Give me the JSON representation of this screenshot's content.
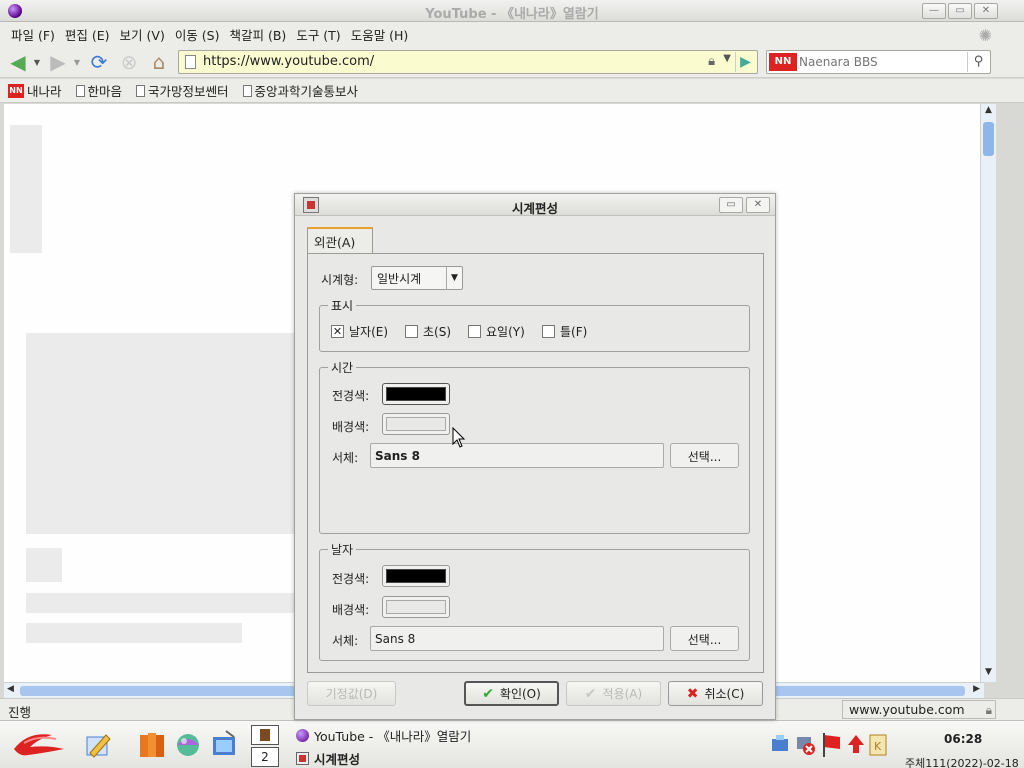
{
  "window": {
    "title": "YouTube - 《내나라》열람기"
  },
  "menu": [
    "파일 (F)",
    "편집 (E)",
    "보기 (V)",
    "이동 (S)",
    "책갈피 (B)",
    "도구 (T)",
    "도움말 (H)"
  ],
  "nav": {
    "url": "https://www.youtube.com/",
    "search_placeholder": "Naenara BBS",
    "search_engine": "NN"
  },
  "bookmarks": [
    "내나라",
    "한마음",
    "국가망정보쎈터",
    "중앙과학기술통보사"
  ],
  "status": {
    "text": "진행",
    "url": "www.youtube.com"
  },
  "taskbar": {
    "workspace": "2",
    "tasks": [
      "YouTube - 《내나라》열람기",
      "시계편성"
    ],
    "clock": "06:28",
    "date": "주체111(2022)-02-18"
  },
  "dialog": {
    "title": "시계편성",
    "tab": "외관(A)",
    "clock_type_label": "시계형:",
    "clock_type_value": "일반시계",
    "display_group": "표시",
    "checks": [
      {
        "label": "날자(E)",
        "checked": true
      },
      {
        "label": "초(S)",
        "checked": false
      },
      {
        "label": "요일(Y)",
        "checked": false
      },
      {
        "label": "틀(F)",
        "checked": false
      }
    ],
    "time_group": {
      "legend": "시간",
      "fg_label": "전경색:",
      "fg_color": "#000000",
      "bg_label": "배경색:",
      "bg_color": "#e8e8e6",
      "font_label": "서체:",
      "font_value": "Sans 8",
      "select_label": "선택..."
    },
    "date_group": {
      "legend": "날자",
      "fg_label": "전경색:",
      "fg_color": "#000000",
      "bg_label": "배경색:",
      "bg_color": "#e8e8e6",
      "font_label": "서체:",
      "font_value": "Sans 8",
      "select_label": "선택..."
    },
    "buttons": {
      "default": "기정값(D)",
      "ok": "확인(O)",
      "apply": "적용(A)",
      "cancel": "취소(C)"
    }
  }
}
